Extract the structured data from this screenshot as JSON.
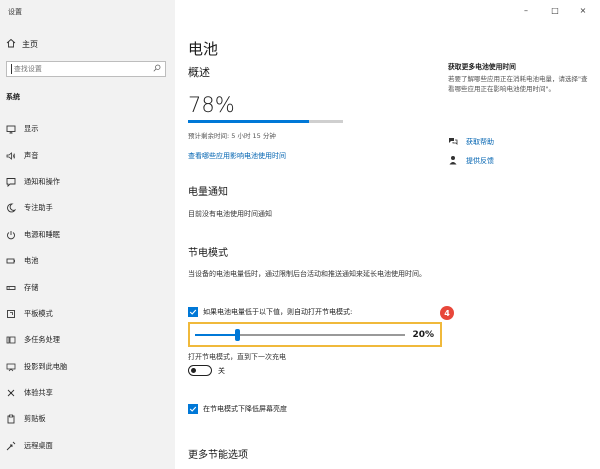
{
  "app": {
    "title": "设置"
  },
  "window": {
    "minimize": "–",
    "maximize": "□",
    "close": "×"
  },
  "sidebar": {
    "home": "主页",
    "search_placeholder": "查找设置",
    "section": "系统",
    "items": [
      {
        "label": "显示",
        "icon": "monitor-icon"
      },
      {
        "label": "声音",
        "icon": "speaker-icon"
      },
      {
        "label": "通知和操作",
        "icon": "notification-icon"
      },
      {
        "label": "专注助手",
        "icon": "moon-icon"
      },
      {
        "label": "电源和睡眠",
        "icon": "power-icon"
      },
      {
        "label": "电池",
        "icon": "battery-icon"
      },
      {
        "label": "存储",
        "icon": "storage-icon"
      },
      {
        "label": "平板模式",
        "icon": "tablet-icon"
      },
      {
        "label": "多任务处理",
        "icon": "multitask-icon"
      },
      {
        "label": "投影到此电脑",
        "icon": "project-icon"
      },
      {
        "label": "体验共享",
        "icon": "share-icon"
      },
      {
        "label": "剪贴板",
        "icon": "clipboard-icon"
      },
      {
        "label": "远程桌面",
        "icon": "remote-icon"
      }
    ]
  },
  "main": {
    "title": "电池",
    "overview": "概述",
    "percent_text": "78%",
    "percent_value": 78,
    "remaining": "预计剩余时间: 5 小时 15 分钟",
    "apps_link": "查看哪些应用影响电池使用时间",
    "notif_title": "电量通知",
    "notif_text": "目前没有电池使用时间通知",
    "saver_title": "节电模式",
    "saver_desc": "当设备的电池电量低时，通过限制后台活动和推送通知来延长电池使用时间。",
    "auto_saver_label": "如果电池电量低于以下值，则自动打开节电模式:",
    "slider_value_text": "20%",
    "slider_value": 20,
    "callout": "4",
    "charge_label": "打开节电模式，直到下一次充电",
    "toggle_state": "关",
    "brightness_label": "在节电模式下降低屏幕亮度",
    "more_title": "更多节能选项"
  },
  "right": {
    "title": "获取更多电池使用时间",
    "desc": "若要了解哪些应用正在消耗电池电量，请选择\"查看哪些应用正在影响电池使用时间\"。",
    "help": "获取帮助",
    "feedback": "提供反馈"
  },
  "colors": {
    "accent": "#0078d7",
    "highlight": "#f0b93b",
    "callout": "#e8473a"
  }
}
